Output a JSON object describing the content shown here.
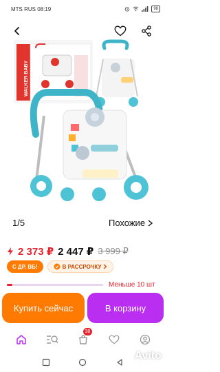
{
  "status": {
    "carrier_time": "MTS RUS 08:19",
    "battery": "98"
  },
  "gallery": {
    "box_text": "WALKER BABY",
    "counter": "1/5"
  },
  "links": {
    "similar": "Похожие"
  },
  "prices": {
    "sale": "2 373 ₽",
    "current": "2 447 ₽",
    "old": "3 999 ₽"
  },
  "badges": {
    "birthday": "С ДР, ВБ!",
    "installment": "В РАССРОЧКУ"
  },
  "stock": {
    "text": "Меньше 10 шт",
    "fill_fraction": 0.06
  },
  "actions": {
    "buy": "Купить сейчас",
    "cart": "В корзину"
  },
  "nav": {
    "cart_count": "38"
  },
  "watermark": "Avito",
  "colors": {
    "accent_orange": "#ff7a00",
    "accent_purple": "#b92ef0",
    "sale_red": "#e5232f"
  }
}
